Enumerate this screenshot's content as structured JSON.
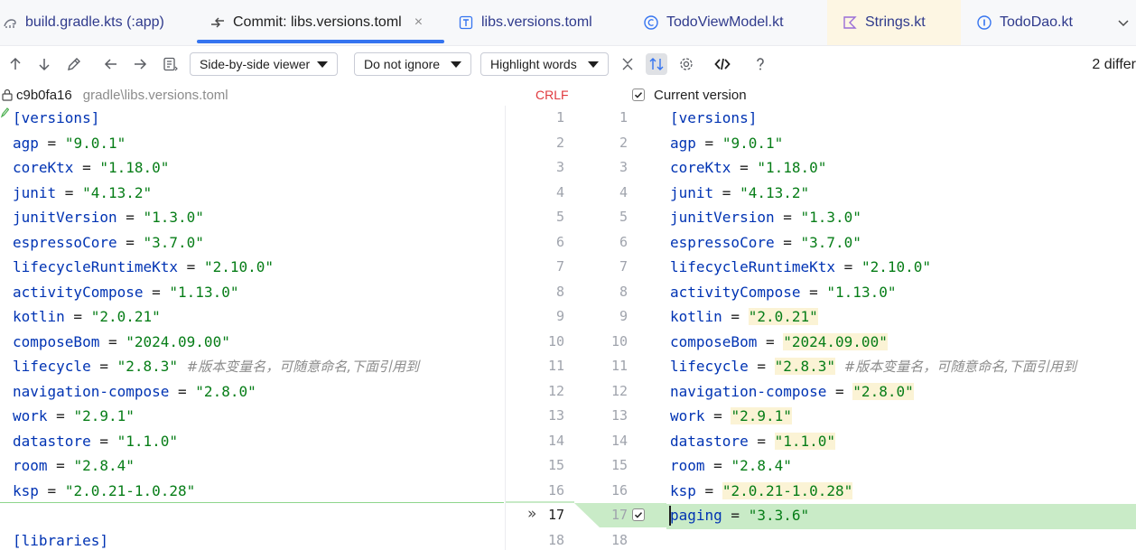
{
  "tabs": [
    {
      "label": "build.gradle.kts (:app)",
      "icon": "gradle-icon",
      "active": false
    },
    {
      "label": "Commit: libs.versions.toml",
      "icon": "commit-diff-icon",
      "active": true
    },
    {
      "label": "libs.versions.toml",
      "icon": "toml-file-icon",
      "active": false
    },
    {
      "label": "TodoViewModel.kt",
      "icon": "kotlin-class-icon",
      "active": false
    },
    {
      "label": "Strings.kt",
      "icon": "kotlin-file-icon",
      "active": false
    },
    {
      "label": "TodoDao.kt",
      "icon": "kotlin-interface-icon",
      "active": false
    }
  ],
  "toolbar": {
    "viewer_label": "Side-by-side viewer",
    "ignore_label": "Do not ignore",
    "highlight_label": "Highlight words",
    "diff_count": "2 differ"
  },
  "header": {
    "left_hash": "c9b0fa16",
    "left_path": "gradle\\libs.versions.toml",
    "line_ending": "CRLF",
    "right_label": "Current version"
  },
  "left_lines": [
    {
      "num": "1",
      "key": "[versions]",
      "type": "section"
    },
    {
      "num": "2",
      "key": "agp",
      "value": "\"9.0.1\""
    },
    {
      "num": "3",
      "key": "coreKtx",
      "value": "\"1.18.0\""
    },
    {
      "num": "4",
      "key": "junit",
      "value": "\"4.13.2\""
    },
    {
      "num": "5",
      "key": "junitVersion",
      "value": "\"1.3.0\""
    },
    {
      "num": "6",
      "key": "espressoCore",
      "value": "\"3.7.0\""
    },
    {
      "num": "7",
      "key": "lifecycleRuntimeKtx",
      "value": "\"2.10.0\""
    },
    {
      "num": "8",
      "key": "activityCompose",
      "value": "\"1.13.0\""
    },
    {
      "num": "9",
      "key": "kotlin",
      "value": "\"2.0.21\""
    },
    {
      "num": "10",
      "key": "composeBom",
      "value": "\"2024.09.00\""
    },
    {
      "num": "11",
      "key": "lifecycle",
      "value": "\"2.8.3\"",
      "comment": "#版本变量名，可随意命名,下面引用到"
    },
    {
      "num": "12",
      "key": "navigation-compose",
      "value": "\"2.8.0\""
    },
    {
      "num": "13",
      "key": "work",
      "value": "\"2.9.1\""
    },
    {
      "num": "14",
      "key": "datastore",
      "value": "\"1.1.0\""
    },
    {
      "num": "15",
      "key": "room",
      "value": "\"2.8.4\""
    },
    {
      "num": "16",
      "key": "ksp",
      "value": "\"2.0.21-1.0.28\""
    },
    {
      "num": "17",
      "key": "",
      "type": "blank"
    },
    {
      "num": "18",
      "key": "[libraries]",
      "type": "section"
    }
  ],
  "right_lines": [
    {
      "num": "1",
      "key": "[versions]",
      "type": "section"
    },
    {
      "num": "2",
      "key": "agp",
      "value": "\"9.0.1\""
    },
    {
      "num": "3",
      "key": "coreKtx",
      "value": "\"1.18.0\""
    },
    {
      "num": "4",
      "key": "junit",
      "value": "\"4.13.2\""
    },
    {
      "num": "5",
      "key": "junitVersion",
      "value": "\"1.3.0\""
    },
    {
      "num": "6",
      "key": "espressoCore",
      "value": "\"3.7.0\""
    },
    {
      "num": "7",
      "key": "lifecycleRuntimeKtx",
      "value": "\"2.10.0\""
    },
    {
      "num": "8",
      "key": "activityCompose",
      "value": "\"1.13.0\""
    },
    {
      "num": "9",
      "key": "kotlin",
      "value": "\"2.0.21\"",
      "hl": true
    },
    {
      "num": "10",
      "key": "composeBom",
      "value": "\"2024.09.00\"",
      "hl": true
    },
    {
      "num": "11",
      "key": "lifecycle",
      "value": "\"2.8.3\"",
      "hl": true,
      "comment": "#版本变量名，可随意命名,下面引用到"
    },
    {
      "num": "12",
      "key": "navigation-compose",
      "value": "\"2.8.0\"",
      "hl": true
    },
    {
      "num": "13",
      "key": "work",
      "value": "\"2.9.1\"",
      "hl": true
    },
    {
      "num": "14",
      "key": "datastore",
      "value": "\"1.1.0\"",
      "hl": true
    },
    {
      "num": "15",
      "key": "room",
      "value": "\"2.8.4\""
    },
    {
      "num": "16",
      "key": "ksp",
      "value": "\"2.0.21-1.0.28\"",
      "hl": true
    },
    {
      "num": "17",
      "key": "paging",
      "value": "\"3.3.6\"",
      "added": true
    },
    {
      "num": "18",
      "key": "",
      "type": "blank"
    }
  ],
  "colors": {
    "accent": "#3574f0",
    "added_line": "#c9ebc7",
    "changed_word": "#fbf3d5",
    "key": "#0033b3",
    "string": "#067d17",
    "crlf": "#e0393e"
  }
}
